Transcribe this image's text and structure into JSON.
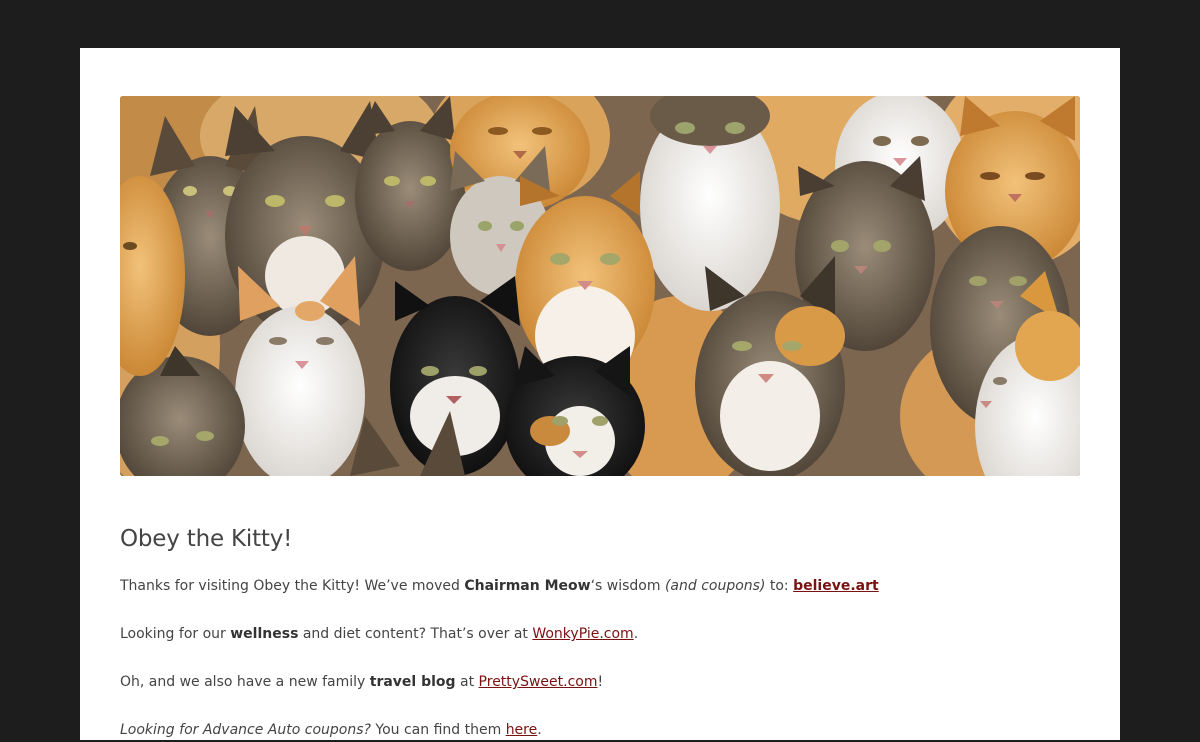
{
  "hero_image": {
    "description_icon": "cat-collage-image"
  },
  "post": {
    "title": "Obey the Kitty!",
    "p1": {
      "a": "Thanks for visiting Obey the Kitty! We’ve moved ",
      "bold": "Chairman Meow",
      "b": "‘s wisdom ",
      "italic": "(and coupons)",
      "c": " to: ",
      "link": "believe.art"
    },
    "p2": {
      "a": "Looking for our ",
      "bold": "wellness",
      "b": " and diet content? That’s over at ",
      "link": "WonkyPie.com",
      "c": "."
    },
    "p3": {
      "a": "Oh, and we also have a new family ",
      "bold": "travel blog",
      "b": " at ",
      "link": "PrettySweet.com",
      "c": "!"
    },
    "p4": {
      "italic": "Looking for Advance Auto coupons?",
      "a": " You can find them ",
      "link": "here",
      "b": "."
    }
  },
  "colors": {
    "background": "#1d1d1d",
    "page": "#ffffff",
    "link": "#7a1212",
    "text": "#444444"
  }
}
